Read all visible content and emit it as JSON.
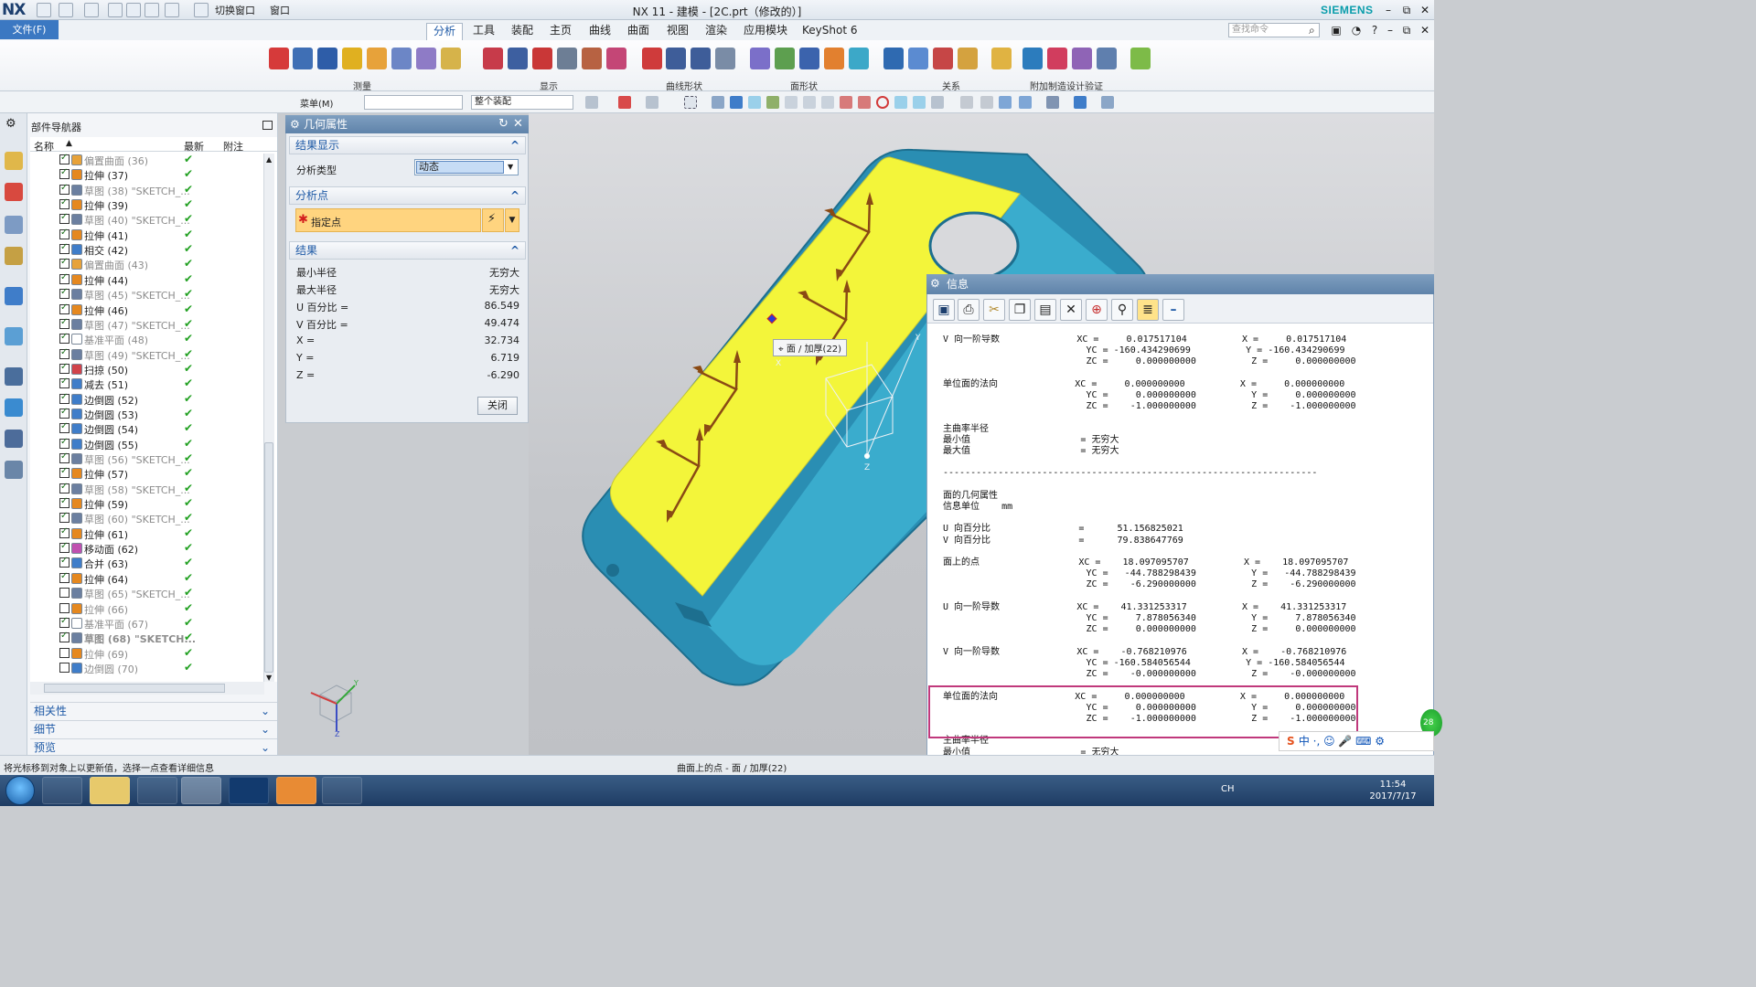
{
  "app": {
    "logo": "NX",
    "window_title": "NX 11 - 建模 - [2C.prt（修改的）]",
    "brand": "SIEMENS",
    "quick_access": {
      "switch_window": "切换窗口",
      "window": "窗口"
    },
    "window_buttons": [
      "–",
      "⧉",
      "✕"
    ]
  },
  "menubar": {
    "file": "文件(F)",
    "tabs": [
      "分析",
      "工具",
      "装配",
      "主页",
      "曲线",
      "曲面",
      "视图",
      "渲染",
      "应用模块",
      "KeyShot 6"
    ],
    "active_tab": "分析",
    "search_placeholder": "查找命令"
  },
  "ribbon": {
    "groups": [
      "测量",
      "显示",
      "曲线形状",
      "面形状",
      "关系",
      "附加制造设计验证"
    ]
  },
  "toolbar2": {
    "menu_label": "菜单(M)",
    "filter_value": "",
    "assembly_value": "整个装配"
  },
  "navigator": {
    "title": "部件导航器",
    "columns": [
      "名称",
      "最新",
      "附注"
    ],
    "rows": [
      {
        "label": "偏置曲面 (36)",
        "dim": true,
        "checked": true,
        "icon": "#e7a23a"
      },
      {
        "label": "拉伸 (37)",
        "dim": false,
        "checked": true,
        "icon": "#e5881f"
      },
      {
        "label": "草图 (38) \"SKETCH_...",
        "dim": true,
        "checked": true,
        "icon": "#6b7fa0"
      },
      {
        "label": "拉伸 (39)",
        "dim": false,
        "checked": true,
        "icon": "#e5881f"
      },
      {
        "label": "草图 (40) \"SKETCH_...",
        "dim": true,
        "checked": true,
        "icon": "#6b7fa0"
      },
      {
        "label": "拉伸 (41)",
        "dim": false,
        "checked": true,
        "icon": "#e5881f"
      },
      {
        "label": "相交 (42)",
        "dim": false,
        "checked": true,
        "icon": "#3f7dc9"
      },
      {
        "label": "偏置曲面 (43)",
        "dim": true,
        "checked": true,
        "icon": "#e7a23a"
      },
      {
        "label": "拉伸 (44)",
        "dim": false,
        "checked": true,
        "icon": "#e5881f"
      },
      {
        "label": "草图 (45) \"SKETCH_...",
        "dim": true,
        "checked": true,
        "icon": "#6b7fa0"
      },
      {
        "label": "拉伸 (46)",
        "dim": false,
        "checked": true,
        "icon": "#e5881f"
      },
      {
        "label": "草图 (47) \"SKETCH_...",
        "dim": true,
        "checked": true,
        "icon": "#6b7fa0"
      },
      {
        "label": "基准平面 (48)",
        "dim": true,
        "checked": true,
        "icon": "#ffffff"
      },
      {
        "label": "草图 (49) \"SKETCH_...",
        "dim": true,
        "checked": true,
        "icon": "#6b7fa0"
      },
      {
        "label": "扫掠 (50)",
        "dim": false,
        "checked": true,
        "icon": "#d1434a"
      },
      {
        "label": "减去 (51)",
        "dim": false,
        "checked": true,
        "icon": "#3f7dc9"
      },
      {
        "label": "边倒圆 (52)",
        "dim": false,
        "checked": true,
        "icon": "#3f7dc9"
      },
      {
        "label": "边倒圆 (53)",
        "dim": false,
        "checked": true,
        "icon": "#3f7dc9"
      },
      {
        "label": "边倒圆 (54)",
        "dim": false,
        "checked": true,
        "icon": "#3f7dc9"
      },
      {
        "label": "边倒圆 (55)",
        "dim": false,
        "checked": true,
        "icon": "#3f7dc9"
      },
      {
        "label": "草图 (56) \"SKETCH_...",
        "dim": true,
        "checked": true,
        "icon": "#6b7fa0"
      },
      {
        "label": "拉伸 (57)",
        "dim": false,
        "checked": true,
        "icon": "#e5881f"
      },
      {
        "label": "草图 (58) \"SKETCH_...",
        "dim": true,
        "checked": true,
        "icon": "#6b7fa0"
      },
      {
        "label": "拉伸 (59)",
        "dim": false,
        "checked": true,
        "icon": "#e5881f"
      },
      {
        "label": "草图 (60) \"SKETCH_...",
        "dim": true,
        "checked": true,
        "icon": "#6b7fa0"
      },
      {
        "label": "拉伸 (61)",
        "dim": false,
        "checked": true,
        "icon": "#e5881f"
      },
      {
        "label": "移动面 (62)",
        "dim": false,
        "checked": true,
        "icon": "#c050b0"
      },
      {
        "label": "合并 (63)",
        "dim": false,
        "checked": true,
        "icon": "#3f7dc9"
      },
      {
        "label": "拉伸 (64)",
        "dim": false,
        "checked": true,
        "icon": "#e5881f"
      },
      {
        "label": "草图 (65) \"SKETCH_...",
        "dim": true,
        "checked": false,
        "icon": "#6b7fa0"
      },
      {
        "label": "拉伸 (66)",
        "dim": true,
        "checked": false,
        "icon": "#e5881f"
      },
      {
        "label": "基准平面 (67)",
        "dim": true,
        "checked": true,
        "icon": "#ffffff"
      },
      {
        "label": "草图 (68) \"SKETCH...",
        "dim": true,
        "bold": true,
        "checked": true,
        "icon": "#6b7fa0"
      },
      {
        "label": "拉伸 (69)",
        "dim": true,
        "checked": false,
        "icon": "#e5881f"
      },
      {
        "label": "边倒圆 (70)",
        "dim": true,
        "checked": false,
        "icon": "#3f7dc9"
      }
    ],
    "accordions": [
      "相关性",
      "细节",
      "预览"
    ]
  },
  "geom_panel": {
    "title": "几何属性",
    "sections": {
      "display": "结果显示",
      "point": "分析点",
      "results": "结果"
    },
    "analysis_type_label": "分析类型",
    "analysis_type_value": "动态",
    "specify_point": "指定点",
    "results": [
      {
        "label": "最小半径",
        "value": "无穷大"
      },
      {
        "label": "最大半径",
        "value": "无穷大"
      },
      {
        "label": "U 百分比 =",
        "value": "86.549"
      },
      {
        "label": "V 百分比 =",
        "value": "49.474"
      },
      {
        "label": "X =",
        "value": "32.734"
      },
      {
        "label": "Y =",
        "value": "6.719"
      },
      {
        "label": "Z =",
        "value": "-6.290"
      }
    ],
    "close": "关闭"
  },
  "viewport": {
    "tooltip": "面 / 加厚(22)",
    "axis_x": "X",
    "axis_y": "Y",
    "axis_z": "Z"
  },
  "info": {
    "title": "信息",
    "text": "V 向一阶导数              XC =     0.017517104          X =     0.017517104\n                          YC = -160.434290699          Y = -160.434290699\n                          ZC =     0.000000000          Z =     0.000000000\n\n单位面的法向              XC =     0.000000000          X =     0.000000000\n                          YC =     0.000000000          Y =     0.000000000\n                          ZC =    -1.000000000          Z =    -1.000000000\n\n主曲率半径\n最小值                    = 无穷大\n最大值                    = 无穷大\n\n--------------------------------------------------------------------\n\n面的几何属性\n信息单位    mm\n\nU 向百分比                =      51.156825021\nV 向百分比                =      79.838647769\n\n面上的点                  XC =    18.097095707          X =    18.097095707\n                          YC =   -44.788298439          Y =   -44.788298439\n                          ZC =    -6.290000000          Z =    -6.290000000\n\nU 向一阶导数              XC =    41.331253317          X =    41.331253317\n                          YC =     7.878056340          Y =     7.878056340\n                          ZC =     0.000000000          Z =     0.000000000\n\nV 向一阶导数              XC =    -0.768210976          X =    -0.768210976\n                          YC = -160.584056544          Y = -160.584056544\n                          ZC =    -0.000000000          Z =    -0.000000000\n\n单位面的法向              XC =     0.000000000          X =     0.000000000\n                          YC =     0.000000000          Y =     0.000000000\n                          ZC =    -1.000000000          Z =    -1.000000000\n\n主曲率半径\n最小值                    = 无穷大\n最大值                    = 无穷大"
  },
  "status": {
    "left": "将光标移到对象上以更新值，选择一点查看详细信息",
    "middle": "曲面上的点 - 面 / 加厚(22)"
  },
  "taskbar": {
    "time": "11:54",
    "date": "2017/7/17",
    "lang": "CH",
    "ime": "中 ·, ☺ 🎤 ⌨ ⚙",
    "badge": "28"
  },
  "colors": {
    "accent": "#1f5aa6",
    "face_yellow": "#f5f53a",
    "face_blue": "#38a8c8",
    "highlight": "#c0397c"
  }
}
